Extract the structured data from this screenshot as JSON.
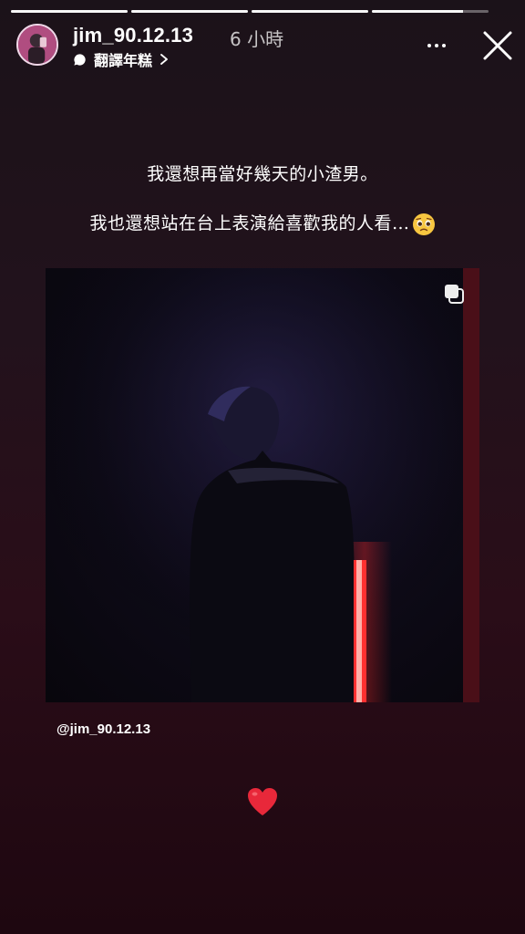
{
  "progress": [
    {
      "fill": 1.0
    },
    {
      "fill": 1.0
    },
    {
      "fill": 1.0
    },
    {
      "fill": 0.78
    }
  ],
  "header": {
    "username": "jim_90.12.13",
    "time_ago": "6 小時",
    "translate_label": "翻譯年糕",
    "more_icon": "more-icon",
    "close_icon": "close-icon"
  },
  "caption": {
    "line1": "我還想再當好幾天的小渣男。",
    "line2": "我也還想站在台上表演給喜歡我的人看…"
  },
  "post": {
    "multi_icon": "multiple-images-icon"
  },
  "mention": "@jim_90.12.13",
  "sticker": "heart-icon",
  "colors": {
    "accent_red": "#ff2a2a",
    "heart": "#e8283a"
  }
}
